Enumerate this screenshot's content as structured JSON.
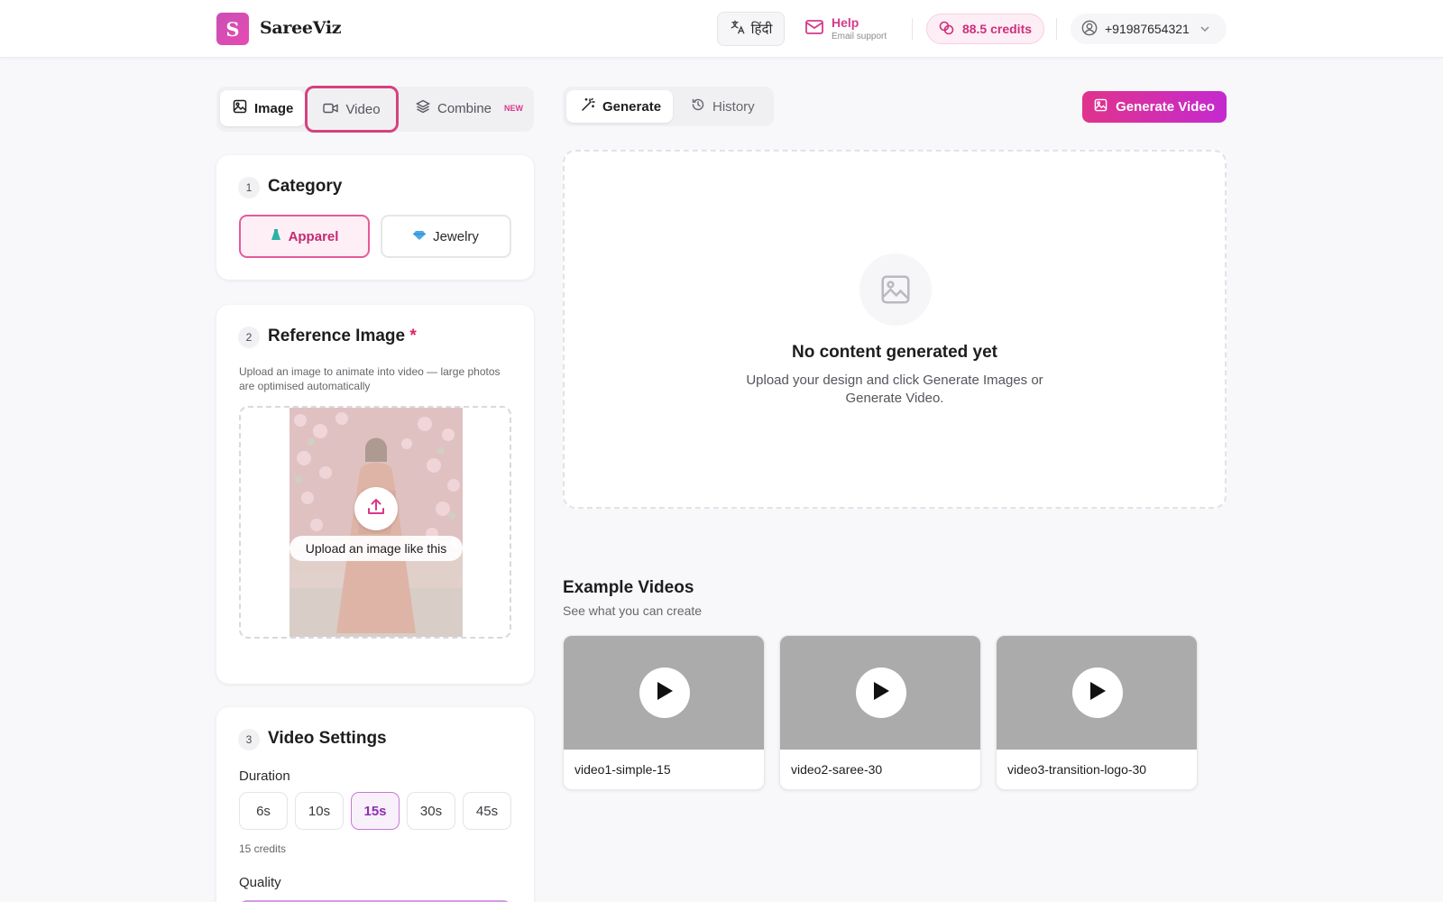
{
  "app": {
    "logo_letter": "S",
    "brand": "SareeViz"
  },
  "header": {
    "language_label": "हिंदी",
    "help_label": "Help",
    "help_sub": "Email support",
    "credits": "88.5 credits",
    "account": "+91987654321"
  },
  "mode_tabs": {
    "image": "Image",
    "video": "Video",
    "combine": "Combine",
    "new_badge": "NEW"
  },
  "category": {
    "step": "1",
    "title": "Category",
    "apparel": "Apparel",
    "jewelry": "Jewelry"
  },
  "reference": {
    "step": "2",
    "title": "Reference Image",
    "required_mark": "*",
    "description": "Upload an image to animate into video — large photos are optimised automatically",
    "upload_label": "Upload an image like this"
  },
  "video_settings": {
    "step": "3",
    "title": "Video Settings",
    "duration_label": "Duration",
    "durations": [
      "6s",
      "10s",
      "15s",
      "30s",
      "45s"
    ],
    "selected_duration": "15s",
    "credits_note": "15 credits",
    "quality_label": "Quality"
  },
  "right_tabs": {
    "generate": "Generate",
    "history": "History"
  },
  "generate_video_button": "Generate Video",
  "empty_state": {
    "title": "No content generated yet",
    "description": "Upload your design and click Generate Images or Generate Video."
  },
  "examples": {
    "title": "Example Videos",
    "subtitle": "See what you can create",
    "videos": [
      "video1-simple-15",
      "video2-saree-30",
      "video3-transition-logo-30"
    ]
  },
  "colors": {
    "accent": "#d6417f",
    "brand_gradient_start": "#e0338b",
    "brand_gradient_end": "#c42ad0"
  }
}
